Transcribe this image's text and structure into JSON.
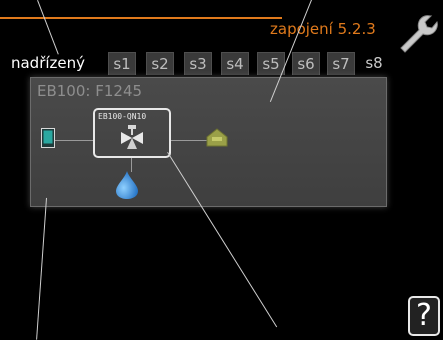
{
  "header": {
    "title": "zapojení 5.2.3"
  },
  "tabs": [
    {
      "label": "nadřízený",
      "state": "active"
    },
    {
      "label": "s1",
      "state": "inactive"
    },
    {
      "label": "s2",
      "state": "inactive"
    },
    {
      "label": "s3",
      "state": "inactive"
    },
    {
      "label": "s4",
      "state": "inactive"
    },
    {
      "label": "s5",
      "state": "inactive"
    },
    {
      "label": "s6",
      "state": "inactive"
    },
    {
      "label": "s7",
      "state": "inactive"
    },
    {
      "label": "s8",
      "state": "plain"
    }
  ],
  "panel": {
    "unit": "EB100:",
    "model": "F1245",
    "valve_label": "EB100-QN10"
  },
  "help": {
    "label": "?"
  },
  "colors": {
    "accent": "#e07a1c",
    "panel": "#444444",
    "water": "#2f7fd0",
    "tank": "#9aa048"
  },
  "icons": [
    "settings-wrench-icon",
    "thermostat-icon",
    "three-way-valve-icon",
    "water-drop-icon",
    "heat-tank-icon",
    "help-icon"
  ]
}
